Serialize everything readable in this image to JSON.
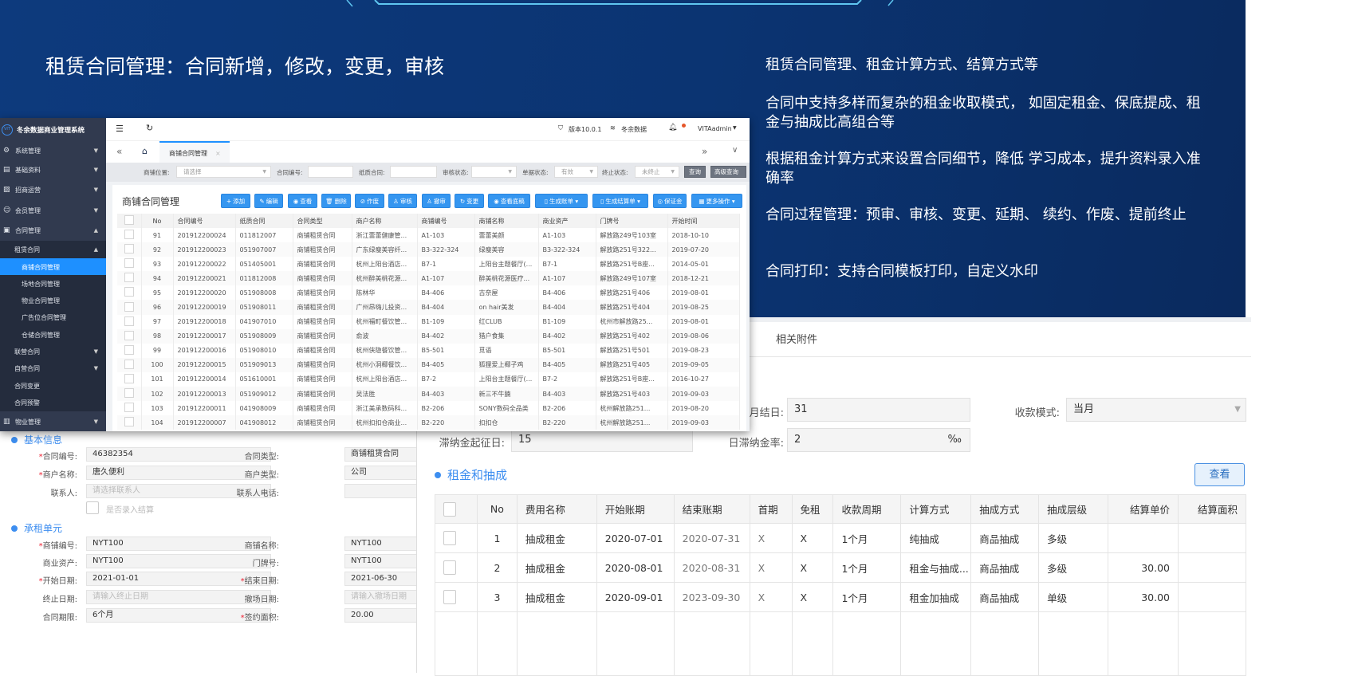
{
  "slide": {
    "title": "租赁合同管理：合同新增，修改，变更，审核",
    "points": [
      "租赁合同管理、租金计算方式、结算方式等",
      "合同中支持多样而复杂的租金收取模式， 如固定租金、保底提成、租金与抽成比高组合等",
      "根据租金计算方式来设置合同细节，降低 学习成本，提升资料录入准确率",
      "合同过程管理：预审、审核、变更、延期、 续约、作废、提前终止",
      "合同打印：支持合同模板打印，自定义水印"
    ]
  },
  "app": {
    "name": "冬余数据商业管理系统",
    "logo": "VIT",
    "sidebar": [
      {
        "label": "系统管理",
        "icon": "gear-icon",
        "glyph": "⚙"
      },
      {
        "label": "基础资料",
        "icon": "database-icon",
        "glyph": "▤"
      },
      {
        "label": "招商运营",
        "icon": "chart-icon",
        "glyph": "▨"
      },
      {
        "label": "会员管理",
        "icon": "users-icon",
        "glyph": "☺"
      },
      {
        "label": "合同管理",
        "icon": "contract-icon",
        "glyph": "▣"
      },
      {
        "label": "租赁合同"
      },
      {
        "label": "商铺合同管理"
      },
      {
        "label": "场地合同管理"
      },
      {
        "label": "物业合同管理"
      },
      {
        "label": "广告位合同管理"
      },
      {
        "label": "仓储合同管理"
      },
      {
        "label": "联营合同"
      },
      {
        "label": "自营合同"
      },
      {
        "label": "合同变更"
      },
      {
        "label": "合同预警"
      },
      {
        "label": "物业管理",
        "icon": "property-icon",
        "glyph": "▥"
      }
    ],
    "header": {
      "version": "版本10.0.1",
      "org": "冬余数据",
      "user": "VITAadmin"
    },
    "tab": "商铺合同管理",
    "filters": [
      {
        "label": "商铺位置:",
        "value": "请选择",
        "placeholder": true,
        "select": true
      },
      {
        "label": "合同编号:",
        "value": ""
      },
      {
        "label": "纸质合同:",
        "value": ""
      },
      {
        "label": "审核状态:",
        "value": "",
        "select": true
      },
      {
        "label": "单据状态:",
        "value": "有效",
        "select": true
      },
      {
        "label": "终止状态:",
        "value": "未终止",
        "select": true
      }
    ],
    "search_label": "查询",
    "advanced_label": "高级查询",
    "content_title": "商铺合同管理",
    "toolbar": [
      {
        "label": "添加",
        "glyph": "+",
        "icon": "plus-icon"
      },
      {
        "label": "编辑",
        "glyph": "✎",
        "icon": "edit-icon"
      },
      {
        "label": "查看",
        "glyph": "◉",
        "icon": "eye-icon"
      },
      {
        "label": "删除",
        "glyph": "🗑",
        "icon": "trash-icon"
      },
      {
        "label": "作废",
        "glyph": "⊘",
        "icon": "void-icon"
      },
      {
        "label": "审核",
        "glyph": "♙",
        "icon": "audit-icon"
      },
      {
        "label": "撤审",
        "glyph": "♙",
        "icon": "unaudit-icon"
      },
      {
        "label": "变更",
        "glyph": "↻",
        "icon": "change-icon"
      },
      {
        "label": "查看底稿",
        "glyph": "◉",
        "icon": "eye-icon"
      },
      {
        "label": "生成账单 ▾",
        "glyph": "▯",
        "icon": "bill-icon"
      },
      {
        "label": "生成结算单 ▾",
        "glyph": "▯",
        "icon": "settlement-icon"
      },
      {
        "label": "保证金",
        "glyph": "◎",
        "icon": "deposit-icon"
      },
      {
        "label": "更多操作 ▾",
        "glyph": "▦",
        "icon": "more-icon"
      }
    ],
    "table": {
      "columns": [
        "No",
        "合同编号",
        "纸质合同",
        "合同类型",
        "商户名称",
        "商铺编号",
        "商铺名称",
        "商业资产",
        "门牌号",
        "开始时间"
      ],
      "rows": [
        [
          "91",
          "201912200024",
          "011812007",
          "商铺租赁合同",
          "浙江蕾蕾健康管...",
          "A1-103",
          "蕾蕾美颜",
          "A1-103",
          "解放路249号103室",
          "2018-10-10"
        ],
        [
          "92",
          "201912200023",
          "051907007",
          "商铺租赁合同",
          "广东绿瘦美容纤...",
          "B3-322-324",
          "绿瘦美容",
          "B3-322-324",
          "解放路251号322...",
          "2019-07-20"
        ],
        [
          "93",
          "201912200022",
          "051405001",
          "商铺租赁合同",
          "杭州上阳台酒店...",
          "B7-1",
          "上阳台主题餐厅(...",
          "B7-1",
          "解放路251号B座...",
          "2014-05-01"
        ],
        [
          "94",
          "201912200021",
          "011812008",
          "商铺租赁合同",
          "杭州醉美桃花源...",
          "A1-107",
          "醉美桃花源医疗...",
          "A1-107",
          "解放路249号107室",
          "2018-12-21"
        ],
        [
          "95",
          "201912200020",
          "051908008",
          "商铺租赁合同",
          "陈林华",
          "B4-406",
          "古奈屋",
          "B4-406",
          "解放路251号406",
          "2019-08-01"
        ],
        [
          "96",
          "201912200019",
          "051908011",
          "商铺租赁合同",
          "广州昂嗨儿投资...",
          "B4-404",
          "on hair美发",
          "B4-404",
          "解放路251号404",
          "2019-08-25"
        ],
        [
          "97",
          "201912200018",
          "041907010",
          "商铺租赁合同",
          "杭州福町餐饮管...",
          "B1-109",
          "红CLUB",
          "B1-109",
          "杭州市解放路25...",
          "2019-08-01"
        ],
        [
          "98",
          "201912200017",
          "051908009",
          "商铺租赁合同",
          "俞波",
          "B4-402",
          "猎户食集",
          "B4-402",
          "解放路251号402",
          "2019-08-06"
        ],
        [
          "99",
          "201912200016",
          "051908010",
          "商铺租赁合同",
          "杭州侠隐餐饮管...",
          "B5-501",
          "觅语",
          "B5-501",
          "解放路251号501",
          "2019-08-23"
        ],
        [
          "100",
          "201912200015",
          "051909013",
          "商铺租赁合同",
          "杭州小洞椰餐饮...",
          "B4-405",
          "狐狸爱上椰子鸡",
          "B4-405",
          "解放路251号405",
          "2019-09-05"
        ],
        [
          "101",
          "201912200014",
          "051610001",
          "商铺租赁合同",
          "杭州上阳台酒店...",
          "B7-2",
          "上阳台主题餐厅(...",
          "B7-2",
          "解放路251号B座...",
          "2016-10-27"
        ],
        [
          "102",
          "201912200013",
          "051909012",
          "商铺租赁合同",
          "吴法胜",
          "B4-403",
          "新三不牛腩",
          "B4-403",
          "解放路251号403",
          "2019-09-03"
        ],
        [
          "103",
          "201912200011",
          "041908009",
          "商铺租赁合同",
          "浙江美承数码科...",
          "B2-206",
          "SONY数码全品类",
          "B2-206",
          "杭州解放路251...",
          "2019-08-20"
        ],
        [
          "104",
          "201912200007",
          "041908012",
          "商铺租赁合同",
          "杭州扣扣仓商业...",
          "B2-220",
          "扣扣仓",
          "B2-220",
          "杭州解放路251...",
          "2019-09-03"
        ]
      ]
    }
  },
  "contract_form": {
    "basic_title": "基本信息",
    "unit_title": "承租单元",
    "fields": [
      {
        "label": "合同编号:",
        "req": true,
        "value": "46382354",
        "label2": "合同类型:",
        "value2": "商铺租赁合同"
      },
      {
        "label": "商户名称:",
        "req": true,
        "value": "唐久便利",
        "label2": "商户类型:",
        "value2": "公司"
      },
      {
        "label": "联系人:",
        "value": "请选择联系人",
        "ph": true,
        "label2": "联系人电话:",
        "value2": ""
      }
    ],
    "checkbox_label": "是否录入结算",
    "unit_fields": [
      {
        "label": "商铺编号:",
        "req": true,
        "value": "NYT100",
        "label2": "商铺名称:",
        "value2": "NYT100"
      },
      {
        "label": "商业资产:",
        "value": "NYT100",
        "label2": "门牌号:",
        "value2": "NYT100"
      },
      {
        "label": "开始日期:",
        "req": true,
        "value": "2021-01-01",
        "label2": "结束日期:",
        "req2": true,
        "value2": "2021-06-30"
      },
      {
        "label": "终止日期:",
        "value": "请输入终止日期",
        "ph": true,
        "label2": "撤场日期:",
        "value2": "请输入撤场日期",
        "ph2": true
      },
      {
        "label": "合同期限:",
        "value": "6个月",
        "label2": "签约面积:",
        "req2": true,
        "value2": "20.00"
      }
    ]
  },
  "rent_panel": {
    "tab": "相关附件",
    "month_end_label": "月结日:",
    "month_end": "31",
    "collect_mode_label": "收款模式:",
    "collect_mode": "当月",
    "late_start_label": "滞纳金起征日:",
    "late_start": "15",
    "late_rate_label": "日滞纳金率:",
    "late_rate": "2",
    "late_rate_unit": "‰",
    "section_title": "租金和抽成",
    "view_button": "查看",
    "columns": [
      "",
      "No",
      "费用名称",
      "开始账期",
      "结束账期",
      "首期",
      "免租",
      "收款周期",
      "计算方式",
      "抽成方式",
      "抽成层级",
      "结算单价",
      "结算面积"
    ],
    "rows": [
      [
        "1",
        "抽成租金",
        "2020-07-01",
        "2020-07-31",
        "X",
        "X",
        "1个月",
        "纯抽成",
        "商品抽成",
        "多级",
        "",
        ""
      ],
      [
        "2",
        "抽成租金",
        "2020-08-01",
        "2020-08-31",
        "X",
        "X",
        "1个月",
        "租金与抽成...",
        "商品抽成",
        "多级",
        "30.00",
        ""
      ],
      [
        "3",
        "抽成租金",
        "2020-09-01",
        "2023-09-30",
        "X",
        "X",
        "1个月",
        "租金加抽成",
        "商品抽成",
        "单级",
        "30.00",
        ""
      ]
    ]
  },
  "colors": {
    "accent": "#3596f0",
    "bg": "#0d3a7d",
    "sidebar": "#313a4f"
  }
}
